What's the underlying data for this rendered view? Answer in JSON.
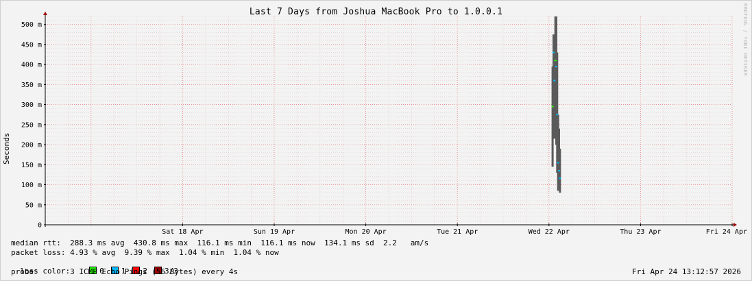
{
  "chart_data": {
    "type": "area",
    "title": "Last 7 Days from Joshua MacBook Pro to 1.0.0.1",
    "ylabel": "Seconds",
    "xlabel": "",
    "ylim": [
      0,
      0.52
    ],
    "yticks": [
      {
        "value": 0,
        "label": "0"
      },
      {
        "value": 0.05,
        "label": "50 m"
      },
      {
        "value": 0.1,
        "label": "100 m"
      },
      {
        "value": 0.15,
        "label": "150 m"
      },
      {
        "value": 0.2,
        "label": "200 m"
      },
      {
        "value": 0.25,
        "label": "250 m"
      },
      {
        "value": 0.3,
        "label": "300 m"
      },
      {
        "value": 0.35,
        "label": "350 m"
      },
      {
        "value": 0.4,
        "label": "400 m"
      },
      {
        "value": 0.45,
        "label": "450 m"
      },
      {
        "value": 0.5,
        "label": "500 m"
      }
    ],
    "xticks": [
      {
        "day": 1.0,
        "label": "Sat 18 Apr"
      },
      {
        "day": 2.0,
        "label": "Sun 19 Apr"
      },
      {
        "day": 3.0,
        "label": "Mon 20 Apr"
      },
      {
        "day": 4.0,
        "label": "Tue 21 Apr"
      },
      {
        "day": 5.0,
        "label": "Wed 22 Apr"
      },
      {
        "day": 6.0,
        "label": "Thu 23 Apr"
      },
      {
        "day": 7.0,
        "label": "Fri 24 Apr"
      }
    ],
    "x_range_days": [
      -0.5,
      7.0
    ],
    "grid": true,
    "smoke_bars": [
      {
        "day": 5.04,
        "low": 0.145,
        "high": 0.395
      },
      {
        "day": 5.05,
        "low": 0.245,
        "high": 0.475
      },
      {
        "day": 5.06,
        "low": 0.215,
        "high": 0.435
      },
      {
        "day": 5.07,
        "low": 0.235,
        "high": 0.52
      },
      {
        "day": 5.08,
        "low": 0.2,
        "high": 0.52
      },
      {
        "day": 5.09,
        "low": 0.13,
        "high": 0.43
      },
      {
        "day": 5.1,
        "low": 0.085,
        "high": 0.275
      },
      {
        "day": 5.11,
        "low": 0.09,
        "high": 0.24
      },
      {
        "day": 5.12,
        "low": 0.08,
        "high": 0.19
      }
    ],
    "median_series": [
      {
        "day": 5.04,
        "value": 0.295,
        "loss": "0"
      },
      {
        "day": 5.05,
        "value": 0.43,
        "loss": "1"
      },
      {
        "day": 5.06,
        "value": 0.36,
        "loss": "1"
      },
      {
        "day": 5.07,
        "value": 0.41,
        "loss": "0"
      },
      {
        "day": 5.08,
        "value": 0.395,
        "loss": "1"
      },
      {
        "day": 5.09,
        "value": 0.275,
        "loss": "1"
      },
      {
        "day": 5.1,
        "value": 0.155,
        "loss": "1"
      },
      {
        "day": 5.11,
        "value": 0.135,
        "loss": "1"
      },
      {
        "day": 5.12,
        "value": 0.116,
        "loss": "1"
      }
    ]
  },
  "watermark": "RRDTOOL / TOBI OETIKER",
  "stats": {
    "median_rtt": "median rtt:  288.3 ms avg  430.8 ms max  116.1 ms min  116.1 ms now  134.1 ms sd  2.2   am/s",
    "packet_loss": "packet loss: 4.93 % avg  9.39 % max  1.04 % min  1.04 % now",
    "loss_color_label": "loss color:",
    "probe": "probe:       3 ICMP Echo Pings (56 Bytes) every 4s",
    "timestamp": "Fri Apr 24 13:12:57 2026"
  },
  "legend": [
    {
      "label": "0",
      "color": "#26ff00"
    },
    {
      "label": "1",
      "color": "#00b8ff"
    },
    {
      "label": "2",
      "color": "#ff0000"
    },
    {
      "label": "3/3",
      "color": "#a10000"
    }
  ],
  "colors": {
    "smoke": "#5a5a5a",
    "grid_minor": "#e0c8c8",
    "grid_major": "#e87a7a",
    "axis": "#000000",
    "arrow": "#a00000"
  }
}
